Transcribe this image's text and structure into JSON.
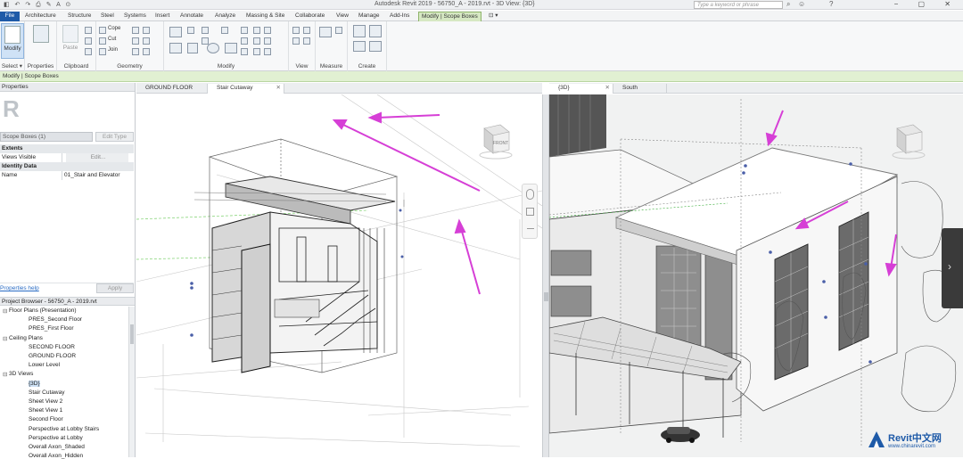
{
  "titlebar": {
    "title": "Autodesk Revit 2019 - 56750_A - 2019.rvt - 3D View: {3D}",
    "search_placeholder": "Type a keyword or phrase"
  },
  "ribbon_tabs": [
    "File",
    "Architecture",
    "Structure",
    "Steel",
    "Systems",
    "Insert",
    "Annotate",
    "Analyze",
    "Massing & Site",
    "Collaborate",
    "View",
    "Manage",
    "Add-Ins",
    "Modify | Scope Boxes"
  ],
  "ribbon": {
    "modify": "Modify",
    "select": "Select ▾",
    "properties": "Properties",
    "clipboard": "Clipboard",
    "geometry": "Geometry",
    "modify_panel": "Modify",
    "view": "View",
    "measure": "Measure",
    "create": "Create",
    "paste": "Paste",
    "cope": "Cope",
    "cut": "Cut",
    "join": "Join"
  },
  "context_bar": "Modify | Scope Boxes",
  "properties": {
    "header": "Properties",
    "type_selector": "Scope Boxes (1)",
    "edit_type": "Edit Type",
    "section_extents": "Extents",
    "views_visible_label": "Views Visible",
    "views_visible_value": "Edit...",
    "section_identity": "Identity Data",
    "name_label": "Name",
    "name_value": "01_Stair and Elevator",
    "help_link": "Properties help",
    "apply": "Apply"
  },
  "browser": {
    "header": "Project Browser - 56750_A - 2019.rvt",
    "items": [
      {
        "label": "Floor Plans (Presentation)",
        "level": 1
      },
      {
        "label": "PRES_Second Floor",
        "level": 2
      },
      {
        "label": "PRES_First Floor",
        "level": 2
      },
      {
        "label": "Ceiling Plans",
        "level": 1
      },
      {
        "label": "SECOND FLOOR",
        "level": 2
      },
      {
        "label": "GROUND FLOOR",
        "level": 2
      },
      {
        "label": "Lower Level",
        "level": 2
      },
      {
        "label": "3D Views",
        "level": 1
      },
      {
        "label": "{3D}",
        "level": 2
      },
      {
        "label": "Stair Cutaway",
        "level": 2
      },
      {
        "label": "Sheet View 2",
        "level": 2
      },
      {
        "label": "Sheet View 1",
        "level": 2
      },
      {
        "label": "Second Floor",
        "level": 2
      },
      {
        "label": "Perspective at Lobby Stairs",
        "level": 2
      },
      {
        "label": "Perspective at Lobby",
        "level": 2
      },
      {
        "label": "Overall Axon_Shaded",
        "level": 2
      },
      {
        "label": "Overall Axon_Hidden",
        "level": 2
      }
    ]
  },
  "view_tabs_left": [
    {
      "label": "GROUND FLOOR"
    },
    {
      "label": "Stair Cutaway"
    }
  ],
  "view_tabs_right": [
    {
      "label": "{3D}"
    },
    {
      "label": "South"
    }
  ],
  "viewcube": {
    "front": "FRONT"
  },
  "watermark": {
    "brand": "Revit中文网",
    "url": "www.chinarevit.com"
  },
  "colors": {
    "accent": "#1e5aa8",
    "arrow": "#d63fd6",
    "context": "#d6e8c3"
  }
}
